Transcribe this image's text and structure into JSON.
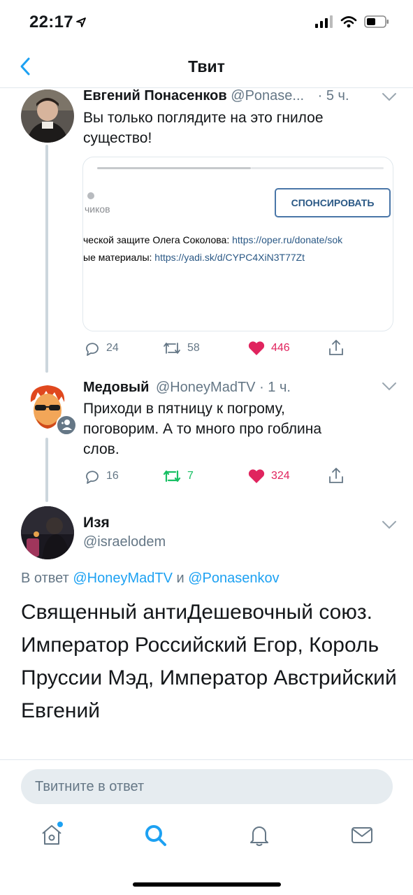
{
  "status_bar": {
    "time": "22:17"
  },
  "header": {
    "title": "Твит"
  },
  "tweets": [
    {
      "name": "Евгений Понасенков",
      "handle": "@Ponase...",
      "time": "· 5 ч.",
      "text_lines": [
        "Вы только поглядите на это гнилое",
        "существо!"
      ],
      "card": {
        "subtitle": "чиков",
        "button": "СПОНСИРОВАТЬ",
        "line1_text": "ческой защите Олега Соколова: ",
        "line1_link": "https://oper.ru/donate/sok",
        "line2_text": "ые материалы: ",
        "line2_link": "https://yadi.sk/d/CYPC4XiN3T77Zt"
      },
      "replies": "24",
      "retweets": "58",
      "likes": "446",
      "liked": true,
      "retweeted": false
    },
    {
      "name": "Медовый",
      "handle": "@HoneyMadTV",
      "time": "· 1 ч.",
      "text_lines": [
        "Приходи в пятницу к погрому,",
        "поговорим. А то много про гоблина",
        "слов."
      ],
      "replies": "16",
      "retweets": "7",
      "likes": "324",
      "liked": true,
      "retweeted": true
    }
  ],
  "main_tweet": {
    "name": "Изя",
    "handle": "@israelodem",
    "replying_prefix": "В ответ ",
    "mention1": "@HoneyMadTV",
    "conj": " и ",
    "mention2": "@Ponasenkov",
    "text": "Священный антиДешевочный союз. Император Российский Егор, Король Пруссии Мэд, Император Австрийский Евгений"
  },
  "reply_box": {
    "placeholder": "Твитните в ответ"
  },
  "colors": {
    "accent": "#1da1f2",
    "like": "#e0245e",
    "retweet": "#17bf63",
    "secondary": "#657786"
  },
  "icons": [
    "back-chevron-icon",
    "reply-icon",
    "retweet-icon",
    "heart-icon",
    "share-icon",
    "home-icon",
    "search-icon",
    "bell-icon",
    "mail-icon"
  ]
}
